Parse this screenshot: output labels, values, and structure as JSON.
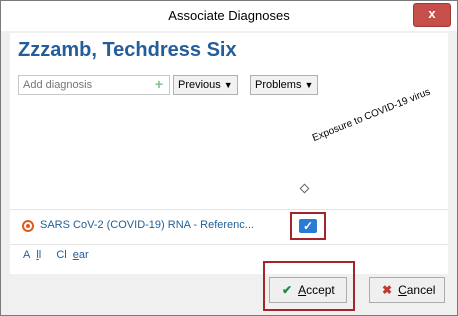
{
  "window": {
    "title": "Associate Diagnoses",
    "close_glyph": "x"
  },
  "patient": {
    "name": "Zzzamb, Techdress Six"
  },
  "toolbar": {
    "add_placeholder": "Add diagnosis",
    "previous_label": "Previous",
    "problems_label": "Problems"
  },
  "grid": {
    "column_header": "Exposure to COVID-19 virus",
    "rows": [
      {
        "label": "SARS CoV-2 (COVID-19) RNA - Referenc...",
        "checked": true
      }
    ]
  },
  "links": {
    "all_first": "A",
    "all_underlined": "l",
    "all_rest": "l",
    "clear_pre": "Cl",
    "clear_underlined": "e",
    "clear_rest": "ar"
  },
  "buttons": {
    "accept_label": "Accept",
    "accept_underlined": "A",
    "accept_rest": "ccept",
    "cancel_underlined": "C",
    "cancel_rest": "ancel"
  },
  "colors": {
    "accent": "#245d9b",
    "highlight": "#a4262c",
    "checkbox": "#2a7bd3"
  }
}
